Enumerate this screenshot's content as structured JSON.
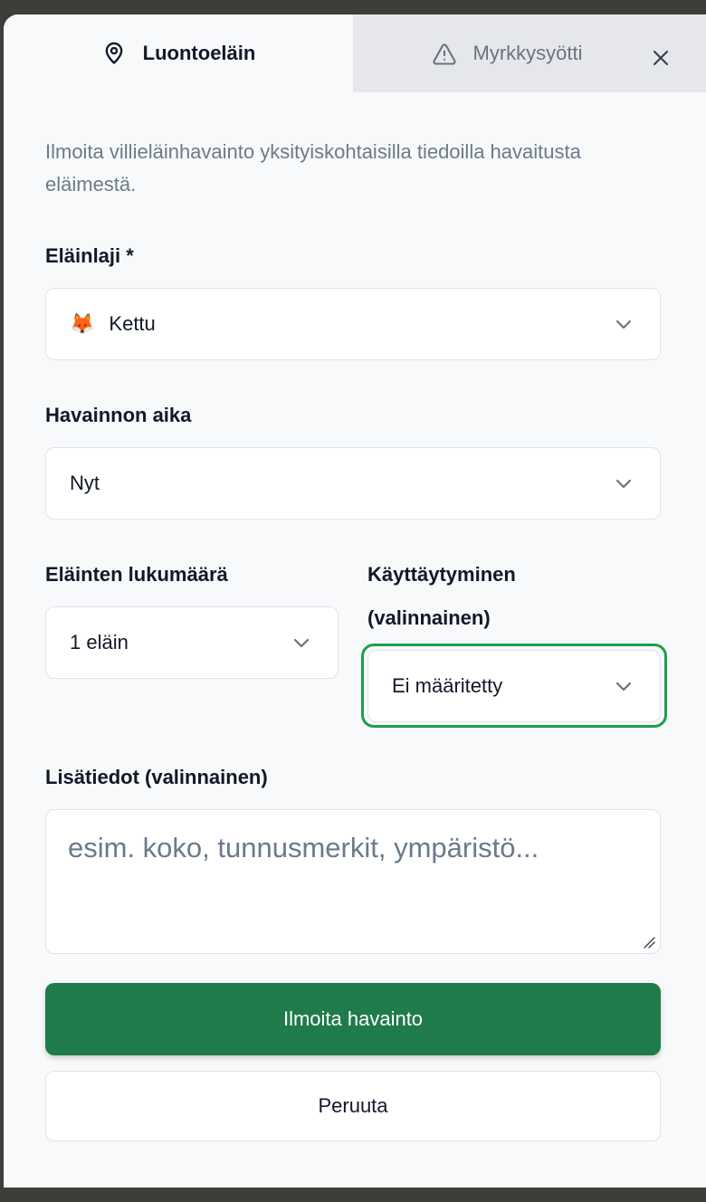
{
  "tabs": [
    {
      "label": "Luontoeläin",
      "icon": "map-pin-icon",
      "active": true
    },
    {
      "label": "Myrkkysyötti",
      "icon": "warning-triangle-icon",
      "active": false
    }
  ],
  "close": {
    "icon": "close-icon"
  },
  "intro": "Ilmoita villieläinhavainto yksityiskohtaisilla tiedoilla havaitusta eläimestä.",
  "species": {
    "label": "Eläinlaji *",
    "emoji": "🦊",
    "value": "Kettu"
  },
  "time": {
    "label": "Havainnon aika",
    "value": "Nyt"
  },
  "count": {
    "label": "Eläinten lukumäärä",
    "value": "1 eläin"
  },
  "behavior": {
    "label_line1": "Käyttäytyminen",
    "label_line2": "(valinnainen)",
    "value": "Ei määritetty"
  },
  "notes": {
    "label": "Lisätiedot (valinnainen)",
    "placeholder": "esim. koko, tunnusmerkit, ympäristö..."
  },
  "actions": {
    "submit": "Ilmoita havainto",
    "cancel": "Peruuta"
  },
  "colors": {
    "primary": "#207b4b",
    "focus": "#1f9d4c",
    "muted_text": "#6b7a8c"
  }
}
